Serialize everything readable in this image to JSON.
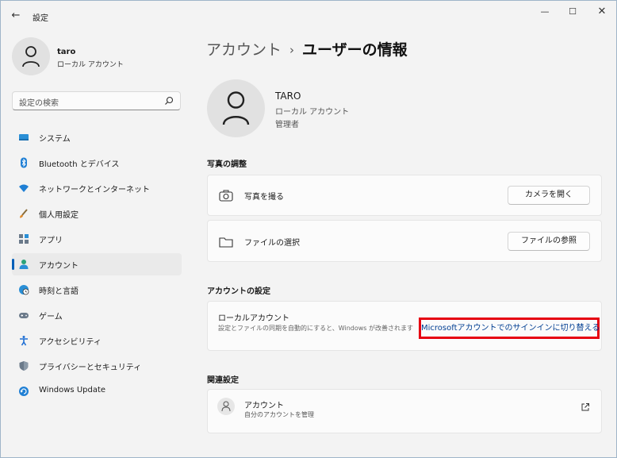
{
  "window": {
    "title": "設定",
    "back_glyph": "←",
    "minimize_glyph": "—",
    "maximize_glyph": "☐",
    "close_glyph": "✕"
  },
  "sidebar": {
    "user": {
      "name": "taro",
      "type": "ローカル アカウント"
    },
    "search": {
      "placeholder": "設定の検索"
    },
    "items": [
      {
        "label": "システム",
        "icon": "monitor-icon",
        "active": false
      },
      {
        "label": "Bluetooth とデバイス",
        "icon": "bluetooth-icon",
        "active": false
      },
      {
        "label": "ネットワークとインターネット",
        "icon": "wifi-icon",
        "active": false
      },
      {
        "label": "個人用設定",
        "icon": "brush-icon",
        "active": false
      },
      {
        "label": "アプリ",
        "icon": "apps-icon",
        "active": false
      },
      {
        "label": "アカウント",
        "icon": "person-icon",
        "active": true
      },
      {
        "label": "時刻と言語",
        "icon": "globe-clock-icon",
        "active": false
      },
      {
        "label": "ゲーム",
        "icon": "gamepad-icon",
        "active": false
      },
      {
        "label": "アクセシビリティ",
        "icon": "accessibility-icon",
        "active": false
      },
      {
        "label": "プライバシーとセキュリティ",
        "icon": "shield-icon",
        "active": false
      },
      {
        "label": "Windows Update",
        "icon": "update-icon",
        "active": false
      }
    ]
  },
  "main": {
    "breadcrumb": {
      "parent": "アカウント",
      "separator": "›",
      "current": "ユーザーの情報"
    },
    "profile": {
      "name": "TARO",
      "type": "ローカル アカウント",
      "role": "管理者"
    },
    "photo_section": {
      "title": "写真の調整",
      "take_photo_label": "写真を撮る",
      "open_camera_button": "カメラを開く",
      "choose_file_label": "ファイルの選択",
      "browse_files_button": "ファイルの参照"
    },
    "account_section": {
      "title": "アカウントの設定",
      "local_title": "ローカルアカウント",
      "local_desc": "設定とファイルの同期を自動的にすると、Windows が改善されます",
      "ms_link": "Microsoftアカウントでのサインインに切り替える"
    },
    "related_section": {
      "title": "関連設定",
      "accounts_title": "アカウント",
      "accounts_desc": "自分のアカウントを管理"
    }
  },
  "colors": {
    "accent": "#005fb8",
    "highlight_box": "#e60012",
    "link": "#003e92"
  }
}
